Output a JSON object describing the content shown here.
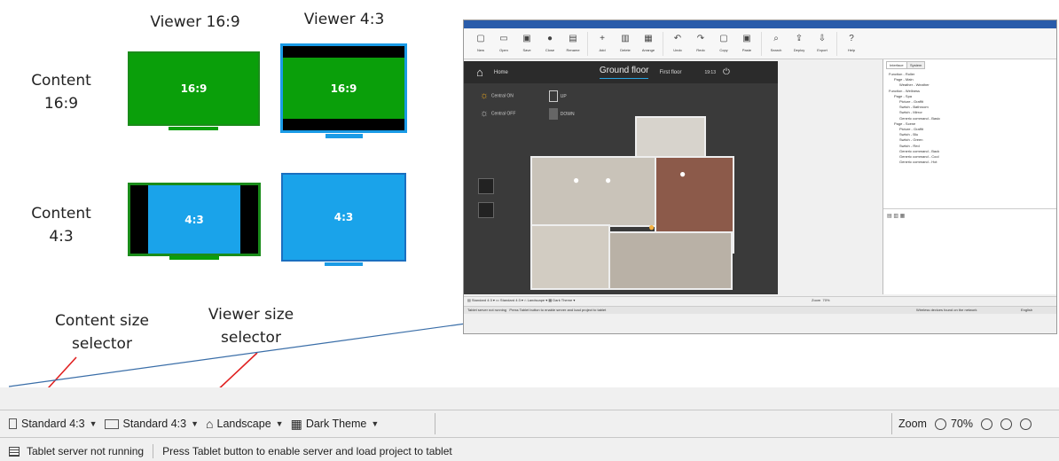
{
  "diagram": {
    "viewer_169_label": "Viewer 16:9",
    "viewer_43_label": "Viewer 4:3",
    "content_169_label_line1": "Content",
    "content_169_label_line2": "16:9",
    "content_43_label_line1": "Content",
    "content_43_label_line2": "4:3",
    "tv_1_text": "16:9",
    "tv_2_text": "16:9",
    "tv_3_text": "4:3",
    "tv_4_text": "4:3",
    "content_selector_line1": "Content size",
    "content_selector_line2": "selector",
    "viewer_selector_line1": "Viewer size",
    "viewer_selector_line2": "selector",
    "colors": {
      "green": "#0a9f0a",
      "green_border": "#1a8c1a",
      "blue": "#1aa3ea",
      "blue_border": "#1a6fc0",
      "arrow": "#e02020"
    }
  },
  "app": {
    "ribbon": [
      "New",
      "Open",
      "Save",
      "Close",
      "Rename",
      "Add",
      "Delete",
      "Arrange",
      "Undo",
      "Redo",
      "Copy",
      "Paste",
      "Search",
      "Deploy",
      "Export",
      "Help"
    ],
    "canvas": {
      "home": "Home",
      "tab_ground": "Ground floor",
      "tab_first": "First floor",
      "clock": "19:13",
      "central_on": "Central ON",
      "central_off": "Central OFF",
      "up": "UP",
      "down": "DOWN"
    },
    "panel": {
      "tab_interface": "Interface",
      "tab_system": "System",
      "tree": [
        "Function - Roller",
        "Page - Main",
        "Weather - Weather",
        "Function - Wellness",
        "Page - Spa",
        "Picture - Graffit",
        "Switch - Bathroom",
        "Switch - Mirror",
        "Generic command - Basic",
        "Page - Scene",
        "Picture - Graffit",
        "Switch - Blu",
        "Switch - Green",
        "Switch - Red",
        "Generic command - Back",
        "Generic command - Cool",
        "Generic command - Hot"
      ]
    },
    "mini_zoom": "Zoom",
    "mini_zoom_value": "70%",
    "mini_devices": "Wireless devices found on the network",
    "mini_language": "English"
  },
  "toolbar": {
    "content_size": "Standard 4:3",
    "viewer_size": "Standard 4:3",
    "orientation": "Landscape",
    "theme": "Dark Theme",
    "zoom_label": "Zoom",
    "zoom_value": "70%"
  },
  "status": {
    "server": "Tablet server not running",
    "hint": "Press Tablet button to enable server and load project to tablet"
  }
}
